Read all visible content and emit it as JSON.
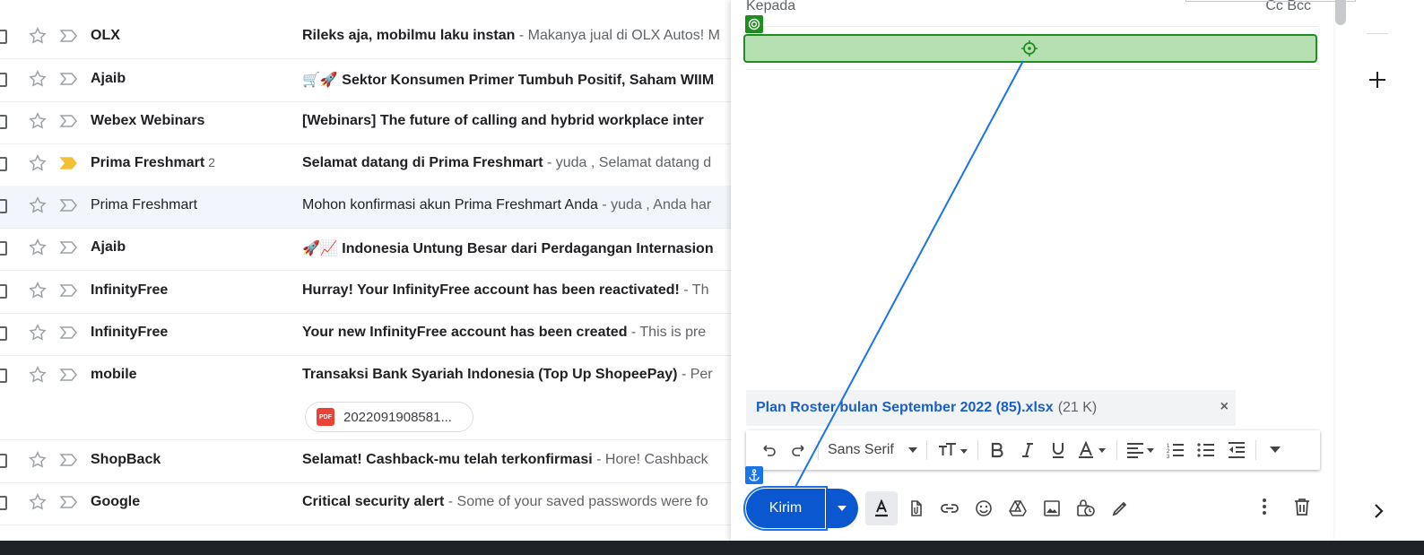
{
  "inbox": {
    "rows": [
      {
        "sender": "OLX",
        "count": "",
        "subject": "Rileks aja, mobilmu laku instan",
        "snippet": " - Makanya jual di OLX Autos! M",
        "unread": true,
        "important": false
      },
      {
        "sender": "Ajaib",
        "count": "",
        "subject": "🛒🚀 Sektor Konsumen Primer Tumbuh Positif, Saham WIIM",
        "snippet": "",
        "unread": true,
        "important": false
      },
      {
        "sender": "Webex Webinars",
        "count": "",
        "subject": "[Webinars] The future of calling and hybrid workplace inter",
        "snippet": "",
        "unread": true,
        "important": false
      },
      {
        "sender": "Prima Freshmart",
        "count": "2",
        "subject": "Selamat datang di Prima Freshmart",
        "snippet": " - yuda , Selamat datang d",
        "unread": true,
        "important": true
      },
      {
        "sender": "Prima Freshmart",
        "count": "",
        "subject": "Mohon konfirmasi akun Prima Freshmart Anda",
        "snippet": " - yuda , Anda har",
        "unread": false,
        "important": false
      },
      {
        "sender": "Ajaib",
        "count": "",
        "subject": "🚀📈 Indonesia Untung Besar dari Perdagangan Internasion",
        "snippet": "",
        "unread": true,
        "important": false
      },
      {
        "sender": "InfinityFree",
        "count": "",
        "subject": "Hurray! Your InfinityFree account has been reactivated!",
        "snippet": " - Th",
        "unread": true,
        "important": false
      },
      {
        "sender": "InfinityFree",
        "count": "",
        "subject": "Your new InfinityFree account has been created",
        "snippet": " - This is pre",
        "unread": true,
        "important": false
      },
      {
        "sender": "mobile",
        "count": "",
        "subject": "Transaksi Bank Syariah Indonesia (Top Up ShopeePay)",
        "snippet": " - Per",
        "unread": true,
        "important": false,
        "attachment": "2022091908581..."
      },
      {
        "sender": "ShopBack",
        "count": "",
        "subject": "Selamat! Cashback-mu telah terkonfirmasi",
        "snippet": " - Hore! Cashback",
        "unread": true,
        "important": false
      },
      {
        "sender": "Google",
        "count": "",
        "subject": "Critical security alert",
        "snippet": " - Some of your saved passwords were fo",
        "unread": true,
        "important": false
      }
    ],
    "pdf_badge": "PDF"
  },
  "compose": {
    "to_label": "Kepada",
    "cc_bcc": "Cc Bcc",
    "attachment_name": "Plan Roster bulan September 2022 (85).xlsx",
    "attachment_size": "(21 K)",
    "attachment_close": "×",
    "font_name": "Sans Serif",
    "send_label": "Kirim"
  },
  "colors": {
    "send": "#0b57d0",
    "highlight_fill": "#b6e0b2",
    "highlight_border": "#1e8e1e",
    "connector": "#1a73e8",
    "important": "#f2c037"
  }
}
